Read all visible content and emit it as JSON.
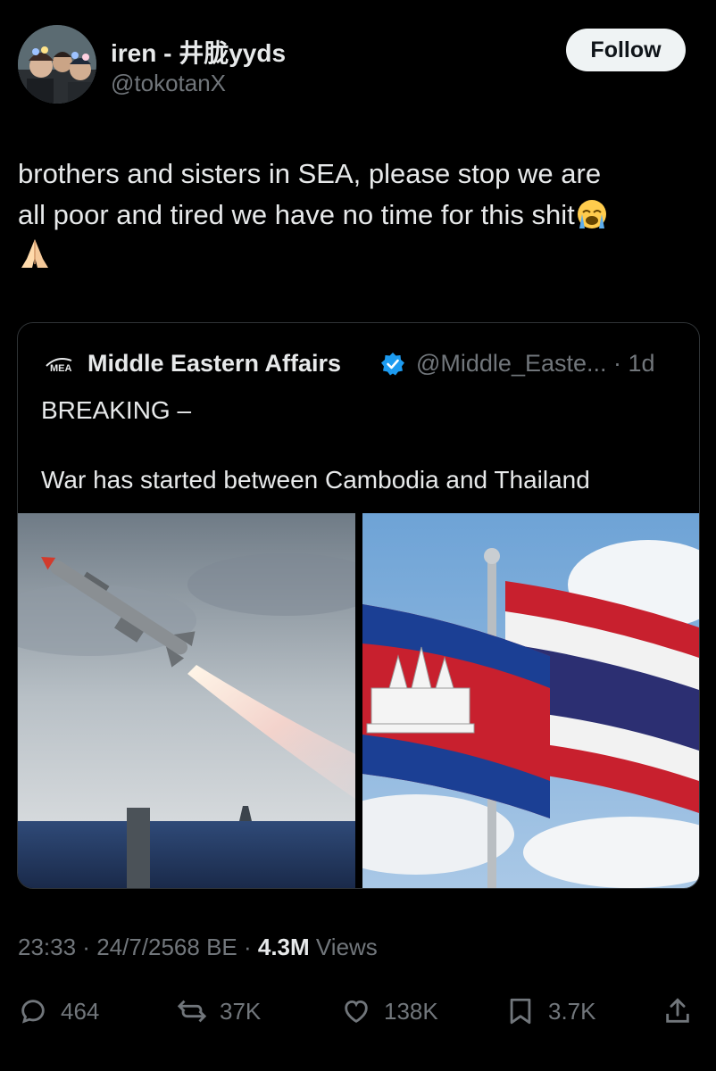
{
  "author": {
    "display_name": "iren - 井胧yyds",
    "handle": "@tokotanX",
    "avatar_icon": "avatar-photo"
  },
  "follow_button": {
    "label": "Follow"
  },
  "tweet": {
    "line1": "brothers and sisters in SEA, please stop we are",
    "line2": "all poor and tired we have no time for this shit",
    "emoji1": "loudly-crying-face",
    "emoji2": "folded-hands"
  },
  "quote": {
    "logo": "MEA",
    "display_name": "Middle Eastern Affairs",
    "handle": "@Middle_Easte...",
    "time": "1d",
    "line1": "BREAKING –",
    "line2": "War has started between Cambodia and Thailand",
    "images": [
      "missile-launch-photo",
      "cambodia-thailand-flags-photo"
    ]
  },
  "meta": {
    "time": "23:33",
    "date": "24/7/2568 BE",
    "views_count": "4.3M",
    "views_label": "Views"
  },
  "actions": {
    "replies": "464",
    "reposts": "37K",
    "likes": "138K",
    "bookmarks": "3.7K"
  },
  "colors": {
    "background": "#000000",
    "text": "#e7e9ea",
    "muted": "#71767b",
    "verified": "#1d9bf0",
    "border": "#2f3336"
  }
}
